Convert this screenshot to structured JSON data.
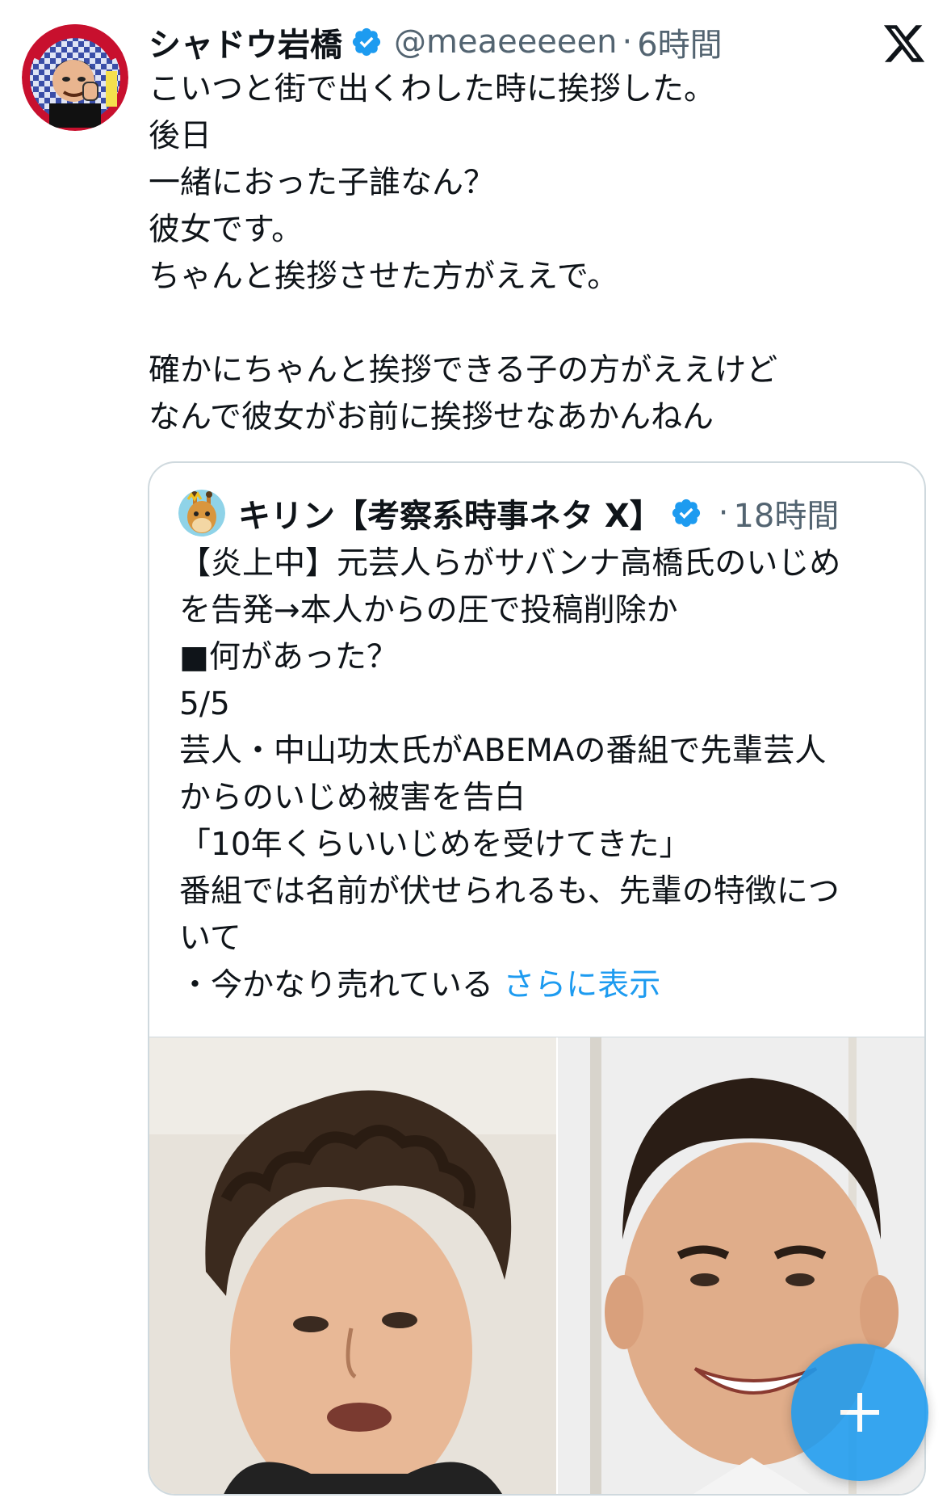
{
  "tweet": {
    "display_name": "シャドウ岩橋",
    "handle": "@meaeeeeen",
    "time": "6時間",
    "separator": "·",
    "verified_icon": "verified-badge-icon",
    "avatar_badge_text": "シャドウ岩橋",
    "lines": [
      "こいつと街で出くわした時に挨拶した。",
      "後日",
      "一緒におった子誰なん？",
      "彼女です。",
      "ちゃんと挨拶させた方がええで。",
      "",
      "確かにちゃんと挨拶できる子の方がええけど",
      "なんで彼女がお前に挨拶せなあかんねん"
    ]
  },
  "quote": {
    "display_name": "キリン【考察系時事ネタ X】",
    "time": "18時間",
    "separator": "·",
    "verified_icon": "verified-badge-icon",
    "lines": [
      "【炎上中】元芸人らがサバンナ高橋氏のいじめ",
      "を告発→本人からの圧で投稿削除か",
      "■何があった？",
      "5/5",
      "芸人・中山功太氏がABEMAの番組で先輩芸人",
      "からのいじめ被害を告白",
      "「10年くらいいじめを受けてきた」",
      "番組では名前が伏せられるも、先輩の特徴につ",
      "いて"
    ],
    "last_line": "・今かなり売れている",
    "show_more": "さらに表示"
  },
  "icons": {
    "x_logo": "x-logo-icon",
    "compose": "plus-icon"
  },
  "colors": {
    "accent": "#1d9bf0",
    "secondary_text": "#536471",
    "border": "#cfd9de"
  }
}
